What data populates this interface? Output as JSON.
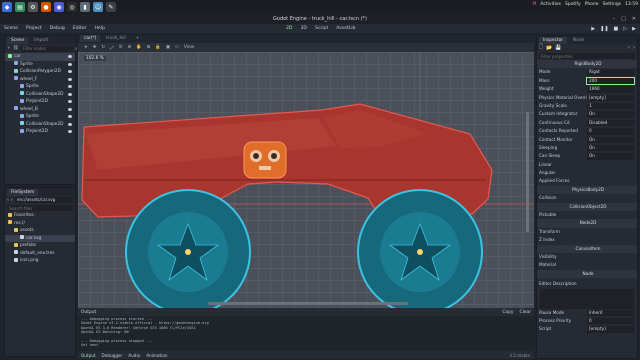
{
  "taskbar": {
    "tray_time": "13:59",
    "tray_items": [
      "M",
      "Activities",
      "Spotify",
      "Phone",
      "Settings"
    ]
  },
  "window": {
    "title": "Godot Engine - truck_hill - car.tscn (*)"
  },
  "menu": {
    "items": [
      "Scene",
      "Project",
      "Debug",
      "Editor",
      "Help"
    ],
    "workspaces": [
      "2D",
      "3D",
      "Script",
      "AssetLib"
    ],
    "active_workspace": "2D"
  },
  "scene_panel": {
    "tabs": [
      "Scene",
      "Import"
    ],
    "filter_placeholder": "Filter nodes",
    "nodes": [
      {
        "name": "car",
        "depth": 0
      },
      {
        "name": "Sprite",
        "depth": 1
      },
      {
        "name": "CollisionPolygon2D",
        "depth": 1
      },
      {
        "name": "wheel_F",
        "depth": 1
      },
      {
        "name": "Sprite",
        "depth": 2
      },
      {
        "name": "CollisionShape2D",
        "depth": 2
      },
      {
        "name": "PinJoint2D",
        "depth": 2
      },
      {
        "name": "wheel_B",
        "depth": 1
      },
      {
        "name": "Sprite",
        "depth": 2
      },
      {
        "name": "CollisionShape2D",
        "depth": 2
      },
      {
        "name": "PinJoint2D",
        "depth": 2
      }
    ]
  },
  "filesystem": {
    "title": "FileSystem",
    "path": "res://assets/car.svg",
    "search_placeholder": "Search files",
    "items": [
      {
        "name": "Favorites:",
        "depth": 0
      },
      {
        "name": "res://",
        "depth": 0
      },
      {
        "name": "assets",
        "depth": 1
      },
      {
        "name": "car.svg",
        "depth": 2,
        "selected": true
      },
      {
        "name": "prefabs",
        "depth": 1
      },
      {
        "name": "default_env.tres",
        "depth": 1
      },
      {
        "name": "icon.png",
        "depth": 1
      }
    ]
  },
  "editor": {
    "doc_tabs": [
      "car(*)",
      "truck_hill"
    ],
    "toolbar_view": "View",
    "zoom": "102.6 %"
  },
  "output": {
    "label": "Output",
    "copy": "Copy",
    "clear": "Clear",
    "lines": [
      "--- Debugging process started ---",
      "Godot Engine v3.2.stable.official - https://godotengine.org",
      "OpenGL ES 3.0 Renderer: GeForce GTX 1660 Ti/PCIe/SSE2",
      "OpenGL ES Batching: ON",
      "",
      "--- Debugging process stopped ---",
      "Set next"
    ],
    "bottom_tabs": [
      "Output",
      "Debugger",
      "Audio",
      "Animation"
    ],
    "version": "3.2.stable"
  },
  "inspector": {
    "tabs": [
      "Inspector",
      "Node"
    ],
    "filter_placeholder": "Filter properties",
    "class": "RigidBody2D",
    "props": [
      {
        "label": "Mode",
        "value": "Rigid"
      },
      {
        "label": "Mass",
        "value": "200"
      },
      {
        "label": "Weight",
        "value": "1960"
      },
      {
        "label": "Physics Material Overrid",
        "value": "[empty]"
      },
      {
        "label": "Gravity Scale",
        "value": "1"
      },
      {
        "label": "Custom Integrator",
        "value": "On"
      },
      {
        "label": "Continuous Cd",
        "value": "Disabled"
      },
      {
        "label": "Contacts Reported",
        "value": "0"
      },
      {
        "label": "Contact Monitor",
        "value": "On"
      },
      {
        "label": "Sleeping",
        "value": "On"
      },
      {
        "label": "Can Sleep",
        "value": "On"
      }
    ],
    "sections": [
      "Linear",
      "Angular",
      "Applied Forces"
    ],
    "inherit": [
      {
        "label": "PhysicsBody2D",
        "kind": "class"
      },
      {
        "label": "Collision",
        "kind": "section"
      },
      {
        "label": "CollisionObject2D",
        "kind": "class"
      },
      {
        "label": "Pickable",
        "kind": "section"
      },
      {
        "label": "Node2D",
        "kind": "class"
      },
      {
        "label": "Transform",
        "kind": "section"
      },
      {
        "label": "Z Index",
        "kind": "section"
      },
      {
        "label": "CanvasItem",
        "kind": "class"
      },
      {
        "label": "Visibility",
        "kind": "section"
      },
      {
        "label": "Material",
        "kind": "section"
      },
      {
        "label": "Node",
        "kind": "class"
      }
    ],
    "editor_desc": "Editor Description",
    "bottom_props": [
      {
        "label": "Pause Mode",
        "value": "Inherit"
      },
      {
        "label": "Process Priority",
        "value": "0"
      },
      {
        "label": "Script",
        "value": "[empty]"
      }
    ]
  }
}
